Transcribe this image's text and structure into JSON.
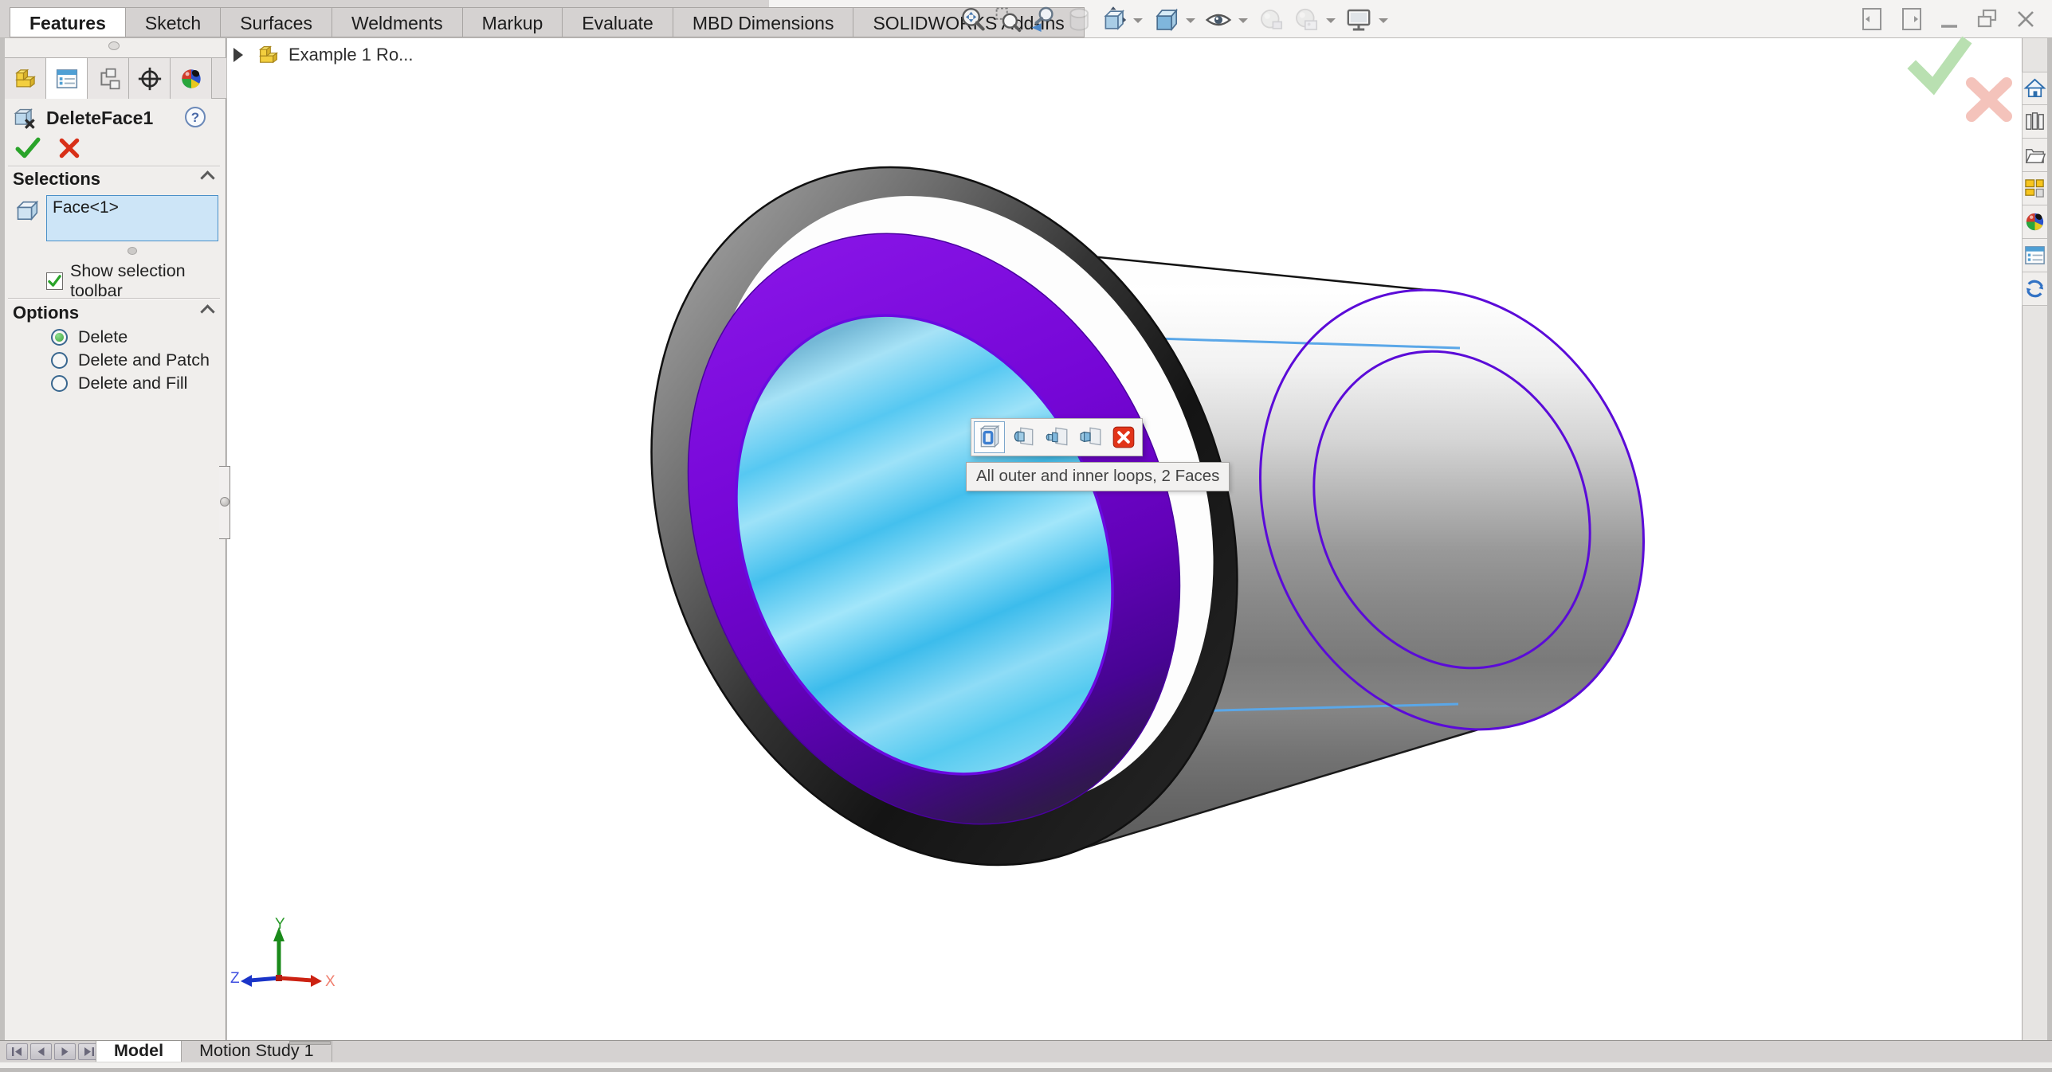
{
  "colors": {
    "accent_purple": "#7505d5",
    "highlight_cyan": "#45c6f2",
    "selection_fill": "#cde5f7",
    "ok_green": "#2aa42a",
    "cancel_red": "#d83018"
  },
  "window": {
    "control_icons": [
      "pane-left",
      "pane-right",
      "minimize",
      "restore",
      "close"
    ]
  },
  "command_tabs": [
    {
      "label": "Features",
      "active": true
    },
    {
      "label": "Sketch",
      "active": false
    },
    {
      "label": "Surfaces",
      "active": false
    },
    {
      "label": "Weldments",
      "active": false
    },
    {
      "label": "Markup",
      "active": false
    },
    {
      "label": "Evaluate",
      "active": false
    },
    {
      "label": "MBD Dimensions",
      "active": false
    },
    {
      "label": "SOLIDWORKS Add-Ins",
      "active": false
    }
  ],
  "headsup_icons": [
    "zoom-to-fit",
    "zoom-to-area",
    "previous-view",
    "section-view",
    "view-orientation",
    "display-style",
    "hide-show-items",
    "edit-appearance",
    "apply-scene",
    "view-settings"
  ],
  "property_manager": {
    "title": "DeleteFace1",
    "help_glyph": "?",
    "tab_icons": [
      "feature-manager",
      "property-manager",
      "configuration-manager",
      "dimxpert-manager",
      "display-manager"
    ],
    "selections": {
      "header": "Selections",
      "items": [
        "Face<1>"
      ],
      "checkbox_label": "Show selection toolbar",
      "checkbox_checked": true
    },
    "options": {
      "header": "Options",
      "radios": [
        {
          "label": "Delete",
          "selected": true
        },
        {
          "label": "Delete and Patch",
          "selected": false
        },
        {
          "label": "Delete and Fill",
          "selected": false
        }
      ]
    }
  },
  "graphics": {
    "tree_flyout": "Example 1 Ro...",
    "selection_popup": {
      "tooltip": "All outer and inner loops, 2 Faces",
      "button_icons": [
        "all-outer-inner-loops",
        "face-option-1",
        "face-option-2",
        "face-option-3",
        "cancel-selection"
      ]
    },
    "triad": {
      "x": "X",
      "y": "Y",
      "z": "Z"
    }
  },
  "task_pane_icons": [
    "home",
    "design-library",
    "file-explorer",
    "view-palette",
    "appearances-scenes",
    "custom-properties",
    "solidworks-resources"
  ],
  "bottom_bar": {
    "tabs": [
      {
        "label": "Model",
        "active": true
      },
      {
        "label": "Motion Study 1",
        "active": false
      }
    ]
  }
}
